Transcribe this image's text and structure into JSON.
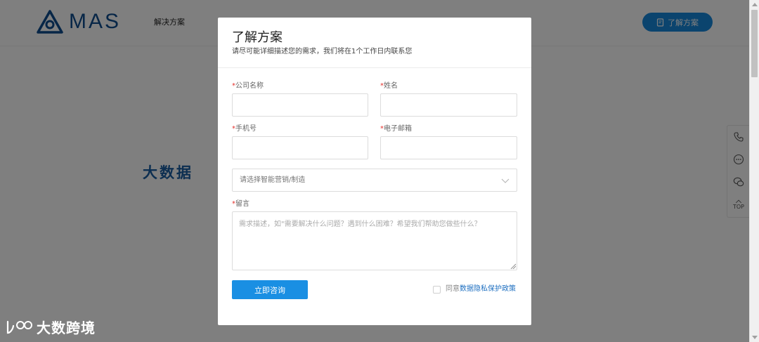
{
  "header": {
    "logo_text": "MAS",
    "nav_items": [
      "解决方案"
    ],
    "cta_label": "了解方案"
  },
  "hero": {
    "title": "大数据"
  },
  "side_tools": {
    "top_label": "TOP"
  },
  "watermark": {
    "text": "大数跨境"
  },
  "modal": {
    "title": "了解方案",
    "subtitle": "请尽可能详细描述您的需求，我们将在1个工作日内联系您",
    "required_mark": "*",
    "fields": {
      "company": {
        "label": "公司名称",
        "value": ""
      },
      "name": {
        "label": "姓名",
        "value": ""
      },
      "phone": {
        "label": "手机号",
        "value": ""
      },
      "email": {
        "label": "电子邮箱",
        "value": ""
      }
    },
    "select": {
      "selected": "请选择智能营销/制造"
    },
    "message": {
      "label": "留言",
      "placeholder": "需求描述，如\"需要解决什么问题？遇到什么困难？希望我们帮助您做些什么？"
    },
    "submit_label": "立即咨询",
    "agree_text": "同意",
    "policy_link": "数据隐私保护政策"
  },
  "colors": {
    "brand": "#0e4d8f",
    "accent": "#1a8fe3",
    "required": "#e5322d",
    "link": "#1e6fc0"
  }
}
